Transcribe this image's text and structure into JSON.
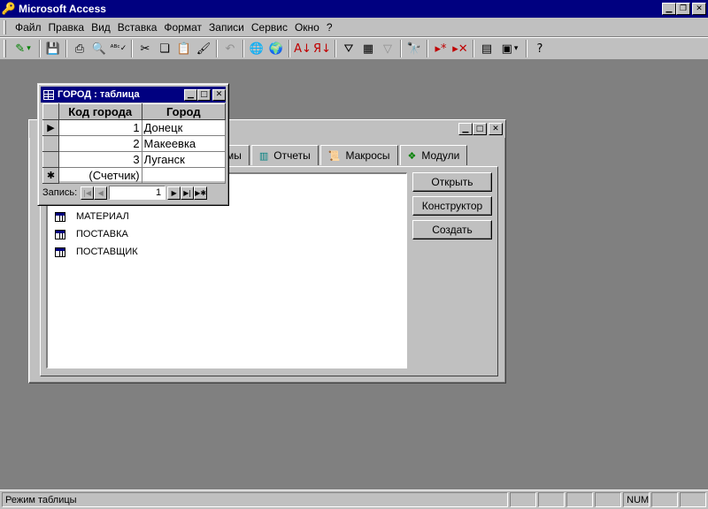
{
  "app": {
    "title": "Microsoft Access"
  },
  "menu": [
    "Файл",
    "Правка",
    "Вид",
    "Вставка",
    "Формат",
    "Записи",
    "Сервис",
    "Окно",
    "?"
  ],
  "toolbar_icons": [
    "view-design-icon",
    "save-icon",
    "print-icon",
    "print-preview-icon",
    "spelling-icon",
    "cut-icon",
    "copy-icon",
    "paste-icon",
    "format-painter-icon",
    "undo-icon",
    "insert-hyperlink-icon",
    "web-toolbar-icon",
    "sort-ascending-icon",
    "sort-descending-icon",
    "filter-by-selection-icon",
    "filter-by-form-icon",
    "apply-filter-icon",
    "find-icon",
    "new-record-icon",
    "delete-record-icon",
    "database-window-icon",
    "new-object-icon",
    "help-icon"
  ],
  "database_window": {
    "tabs": [
      {
        "label": "мы",
        "icon": "form-icon"
      },
      {
        "label": "Отчеты",
        "icon": "report-icon"
      },
      {
        "label": "Макросы",
        "icon": "macro-icon"
      },
      {
        "label": "Модули",
        "icon": "module-icon"
      }
    ],
    "objects": [
      "МАТЕРИАЛ",
      "ПОСТАВКА",
      "ПОСТАВЩИК"
    ],
    "buttons": {
      "open": "Открыть",
      "design": "Конструктор",
      "create": "Создать"
    }
  },
  "datasheet": {
    "title": "ГОРОД : таблица",
    "columns": [
      "Код города",
      "Город"
    ],
    "rows": [
      {
        "id": "1",
        "city": "Донецк"
      },
      {
        "id": "2",
        "city": "Макеевка"
      },
      {
        "id": "3",
        "city": "Луганск"
      }
    ],
    "new_row_placeholder": "(Счетчик)",
    "nav": {
      "label": "Запись:",
      "current": "1"
    }
  },
  "status": {
    "text": "Режим таблицы",
    "num": "NUM"
  }
}
